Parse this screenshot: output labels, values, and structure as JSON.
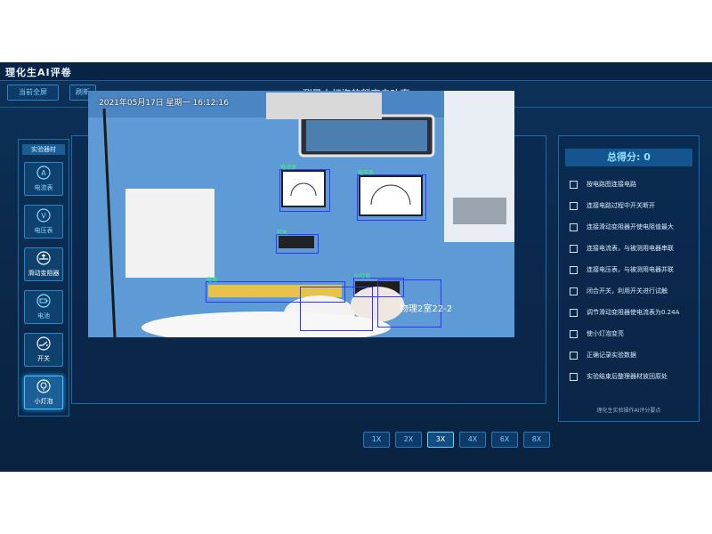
{
  "app": {
    "title": "理化生AI评卷"
  },
  "header": {
    "fullscreen_label": "当前全屏",
    "refresh_label": "刷新",
    "page_title": "测量小灯泡的额定电功率"
  },
  "sidebar": {
    "heading": "实验器材",
    "items": [
      {
        "label": "电流表"
      },
      {
        "label": "电压表"
      },
      {
        "label": "滑动变阻器"
      },
      {
        "label": "电池"
      },
      {
        "label": "开关"
      },
      {
        "label": "小灯泡"
      }
    ]
  },
  "video": {
    "timestamp": "2021年05月17日 星期一 16:12:16",
    "room_label": "物理2室22-2",
    "detections": [
      {
        "label": "电流表"
      },
      {
        "label": "电压表"
      },
      {
        "label": "开关"
      },
      {
        "label": "电池"
      },
      {
        "label": "小灯泡"
      }
    ]
  },
  "score": {
    "heading": "总得分: 0",
    "criteria": [
      "按电路图连接电路",
      "连接电路过程中开关断开",
      "连接滑动变阻器开使电阻值最大",
      "连接电流表，与被测用电器串联",
      "连接电压表，与被测用电器并联",
      "闭合开关，利用开关进行试触",
      "调节滑动变阻器使电流表为0.24A",
      "使小灯泡变亮",
      "正确记录实验数据",
      "实验结束后整理器材放回原处"
    ],
    "footer": "理化生实验操作AI评分要点"
  },
  "zoom": {
    "levels": [
      "1X",
      "2X",
      "3X",
      "4X",
      "6X",
      "8X"
    ],
    "selected": "3X"
  },
  "colors": {
    "accent": "#3fc2ff",
    "background": "#0b2a4e",
    "bbox": "#2b39ff",
    "bbox_label": "#39ff6a"
  }
}
